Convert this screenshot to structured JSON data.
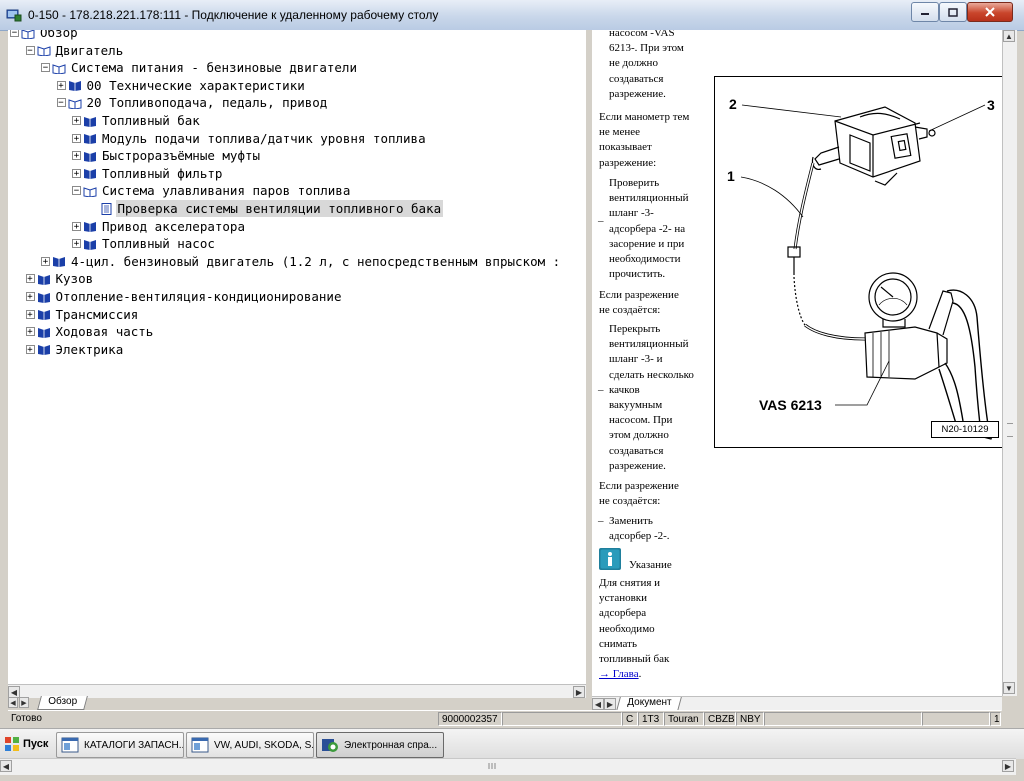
{
  "window": {
    "title": "0-150 - 178.218.221.178:111 - Подключение к удаленному рабочему столу"
  },
  "tree": {
    "rows": [
      {
        "level": 0,
        "expander": "−",
        "label": "Обзор",
        "open": true
      },
      {
        "level": 1,
        "expander": "−",
        "label": "Двигатель",
        "open": true
      },
      {
        "level": 2,
        "expander": "−",
        "label": "Система питания - бензиновые двигатели",
        "open": true
      },
      {
        "level": 3,
        "expander": "+",
        "label": "00 Технические характеристики",
        "open": false
      },
      {
        "level": 3,
        "expander": "−",
        "label": "20 Топливоподача, педаль, привод",
        "open": true
      },
      {
        "level": 4,
        "expander": "+",
        "label": "Топливный бак",
        "open": false
      },
      {
        "level": 4,
        "expander": "+",
        "label": "Модуль подачи топлива/датчик уровня топлива",
        "open": false
      },
      {
        "level": 4,
        "expander": "+",
        "label": "Быстроразъёмные муфты",
        "open": false
      },
      {
        "level": 4,
        "expander": "+",
        "label": "Топливный фильтр",
        "open": false
      },
      {
        "level": 4,
        "expander": "−",
        "label": "Система улавливания паров топлива",
        "open": true
      },
      {
        "level": 5,
        "expander": "",
        "label": "Проверка системы вентиляции топливного бака",
        "open": false,
        "doc": true,
        "selected": true
      },
      {
        "level": 4,
        "expander": "+",
        "label": "Привод акселератора",
        "open": false
      },
      {
        "level": 4,
        "expander": "+",
        "label": "Топливный насос",
        "open": false
      },
      {
        "level": 2,
        "expander": "+",
        "label": "4-цил. бензиновый двигатель (1.2 л, с непосредственным впрыском :",
        "open": false
      },
      {
        "level": 1,
        "expander": "+",
        "label": "Кузов",
        "open": false
      },
      {
        "level": 1,
        "expander": "+",
        "label": "Отопление-вентиляция-кондиционирование",
        "open": false
      },
      {
        "level": 1,
        "expander": "+",
        "label": "Трансмиссия",
        "open": false
      },
      {
        "level": 1,
        "expander": "+",
        "label": "Ходовая часть",
        "open": false
      },
      {
        "level": 1,
        "expander": "+",
        "label": "Электрика",
        "open": false
      }
    ]
  },
  "left_tab": "Обзор",
  "right_tab": "Документ",
  "document": {
    "p1": [
      "насосом -VAS",
      "6213-. При этом",
      "не должно",
      "создаваться",
      "разрежение."
    ],
    "p2": [
      "Если манометр тем",
      "не менее",
      "показывает",
      "разрежение:"
    ],
    "p3": [
      "Проверить",
      "вентиляционный",
      "шланг -3-",
      "адсорбера -2- на",
      "засорение и при",
      "необходимости",
      "прочистить."
    ],
    "p4": [
      "Если разрежение",
      "не создаётся:"
    ],
    "p5": [
      "Перекрыть",
      "вентиляционный",
      "шланг -3- и",
      "сделать несколько",
      "качков",
      "вакуумным",
      "насосом. При",
      "этом должно",
      "создаваться",
      "разрежение."
    ],
    "p6": [
      "Если разрежение",
      "не создаётся:"
    ],
    "p7": [
      "Заменить",
      "адсорбер -2-."
    ],
    "note_title": "Указание",
    "p8": [
      "Для снятия и",
      "установки",
      "адсорбера",
      "необходимо",
      "снимать",
      "топливный бак"
    ],
    "link": "→ Глава",
    "link_tail": ".",
    "dash": "–"
  },
  "figure": {
    "callout_1": "1",
    "callout_2": "2",
    "callout_3": "3",
    "tool_label": "VAS 6213",
    "ref": "N20-10129"
  },
  "status": {
    "text": "Готово",
    "code": "9000002357",
    "c": "C",
    "model_code": "1T3",
    "model": "Touran",
    "engine": "CBZB",
    "gearbox": "NBY",
    "page": "1"
  },
  "taskbar": {
    "start": "Пуск",
    "items": [
      {
        "label": "КАТАЛОГИ ЗАПАСН..."
      },
      {
        "label": "VW, AUDI, SKODA, S..."
      },
      {
        "label": "Электронная спра..."
      }
    ]
  },
  "colors": {
    "book": "#1b3fa8",
    "selection": "#d8d8d8",
    "link": "#0000cc"
  }
}
